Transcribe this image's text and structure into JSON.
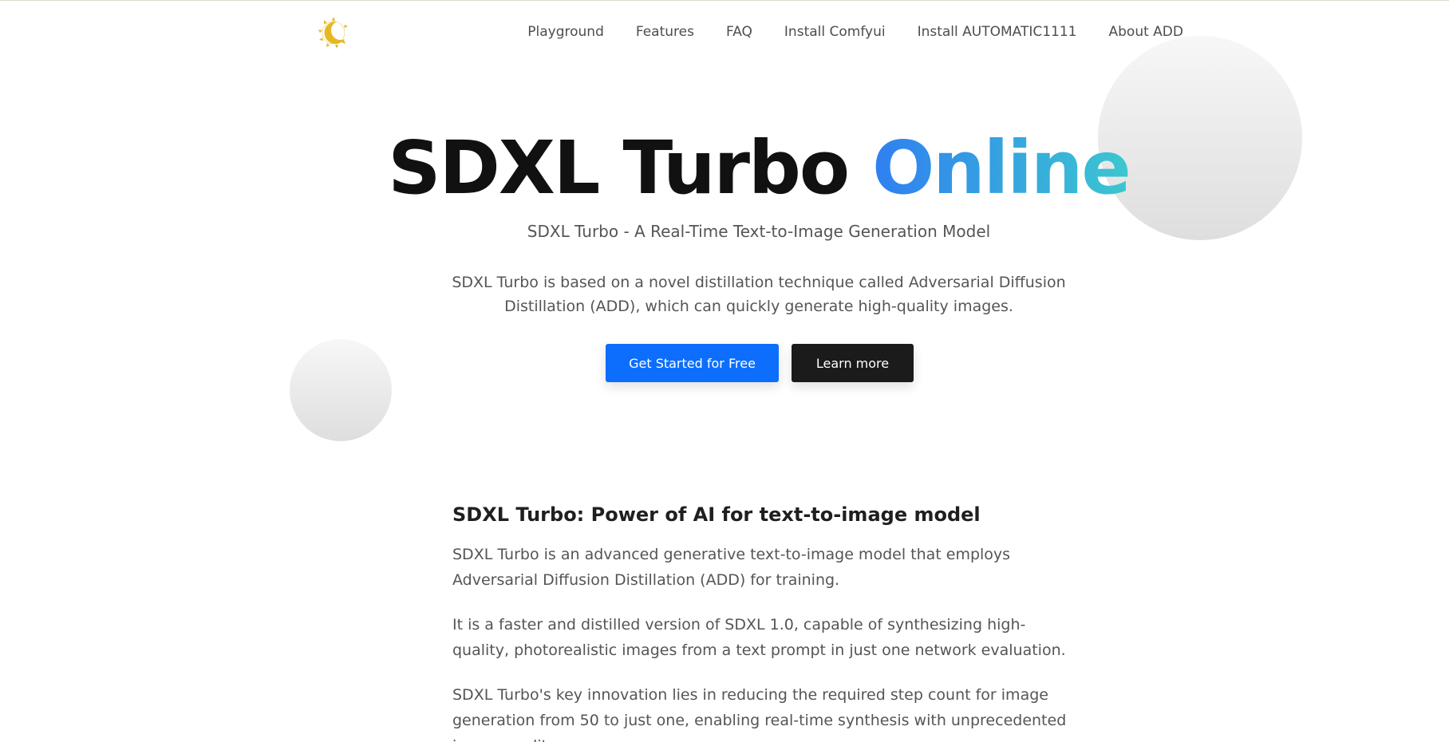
{
  "header": {
    "nav": [
      {
        "label": "Playground"
      },
      {
        "label": "Features"
      },
      {
        "label": "FAQ"
      },
      {
        "label": "Install Comfyui"
      },
      {
        "label": "Install AUTOMATIC1111"
      },
      {
        "label": "About ADD"
      }
    ]
  },
  "hero": {
    "title_main": "SDXL Turbo",
    "title_accent": "Online",
    "subtitle": "SDXL Turbo - A Real-Time Text-to-Image Generation Model",
    "description": "SDXL Turbo is based on a novel distillation technique called Adversarial Diffusion Distillation (ADD), which can quickly generate high-quality images.",
    "primary_button": "Get Started for Free",
    "secondary_button": "Learn more"
  },
  "section": {
    "heading": "SDXL Turbo: Power of AI for text-to-image model",
    "paragraphs": [
      "SDXL Turbo is an advanced generative text-to-image model that employs Adversarial Diffusion Distillation (ADD) for training.",
      "It is a faster and distilled version of SDXL 1.0, capable of synthesizing high-quality, photorealistic images from a text prompt in just one network evaluation.",
      "SDXL Turbo's key innovation lies in reducing the required step count for image generation from 50 to just one, enabling real-time synthesis with unprecedented image quality."
    ]
  },
  "colors": {
    "accent_start": "#2f7ff0",
    "accent_end": "#3cc7d0",
    "primary_button": "#0d6efd",
    "dark_button": "#1b1b1b",
    "logo": "#e6b821"
  },
  "icons": {
    "logo": "crescent-sun-logo-icon"
  }
}
